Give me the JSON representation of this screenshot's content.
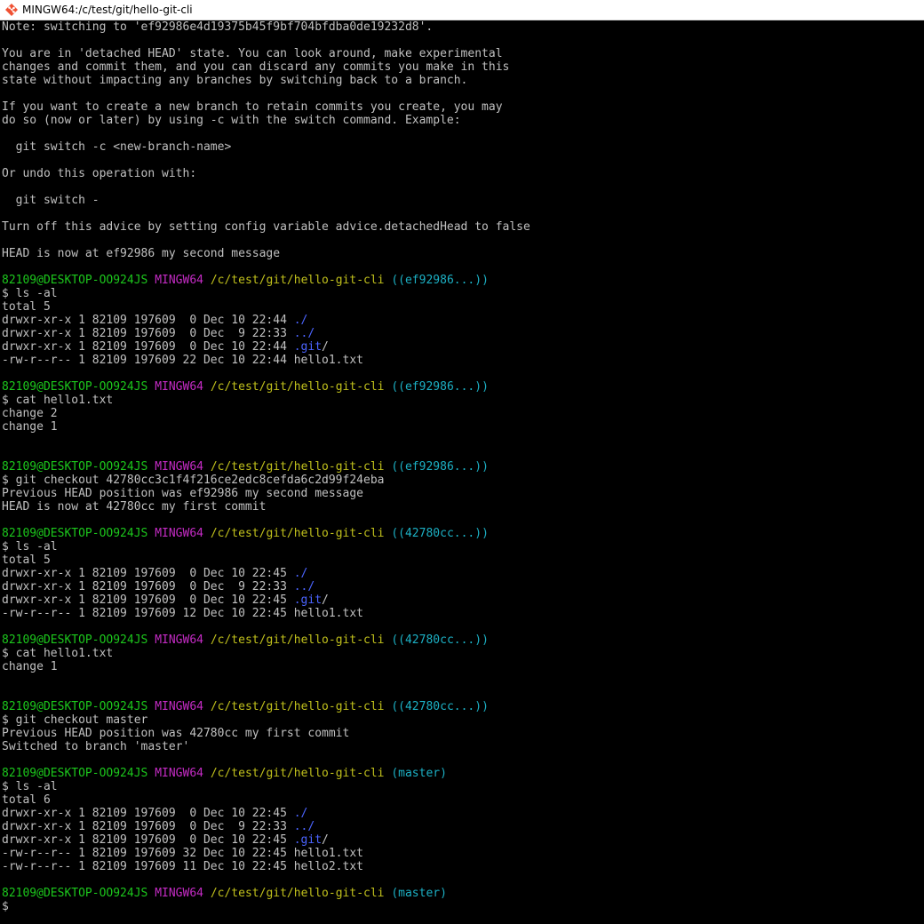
{
  "window": {
    "title": "MINGW64:/c/test/git/hello-git-cli"
  },
  "colors": {
    "background": "#000000",
    "text": "#c0c0c0",
    "user_host": "#1cc71c",
    "system": "#c42bc4",
    "path": "#c0c01c",
    "branch": "#1cb0c4",
    "directory": "#4b64ff"
  },
  "icons": {
    "app": "git-bash-icon"
  },
  "terminal": {
    "lines": [
      [
        {
          "t": "text",
          "v": "Note: switching to 'ef92986e4d19375b45f9bf704bfdba0de19232d8'."
        }
      ],
      [],
      [
        {
          "t": "text",
          "v": "You are in 'detached HEAD' state. You can look around, make experimental"
        }
      ],
      [
        {
          "t": "text",
          "v": "changes and commit them, and you can discard any commits you make in this"
        }
      ],
      [
        {
          "t": "text",
          "v": "state without impacting any branches by switching back to a branch."
        }
      ],
      [],
      [
        {
          "t": "text",
          "v": "If you want to create a new branch to retain commits you create, you may"
        }
      ],
      [
        {
          "t": "text",
          "v": "do so (now or later) by using -c with the switch command. Example:"
        }
      ],
      [],
      [
        {
          "t": "text",
          "v": "  git switch -c <new-branch-name>"
        }
      ],
      [],
      [
        {
          "t": "text",
          "v": "Or undo this operation with:"
        }
      ],
      [],
      [
        {
          "t": "text",
          "v": "  git switch -"
        }
      ],
      [],
      [
        {
          "t": "text",
          "v": "Turn off this advice by setting config variable advice.detachedHead to false"
        }
      ],
      [],
      [
        {
          "t": "text",
          "v": "HEAD is now at ef92986 my second message"
        }
      ],
      [],
      [
        {
          "t": "user",
          "v": "82109@DESKTOP-OO924JS"
        },
        {
          "t": "text",
          "v": " "
        },
        {
          "t": "sys",
          "v": "MINGW64"
        },
        {
          "t": "text",
          "v": " "
        },
        {
          "t": "path",
          "v": "/c/test/git/hello-git-cli"
        },
        {
          "t": "text",
          "v": " "
        },
        {
          "t": "branch",
          "v": "((ef92986...))"
        }
      ],
      [
        {
          "t": "text",
          "v": "$ ls -al"
        }
      ],
      [
        {
          "t": "text",
          "v": "total 5"
        }
      ],
      [
        {
          "t": "text",
          "v": "drwxr-xr-x 1 82109 197609  0 Dec 10 22:44 "
        },
        {
          "t": "dir",
          "v": "./"
        }
      ],
      [
        {
          "t": "text",
          "v": "drwxr-xr-x 1 82109 197609  0 Dec  9 22:33 "
        },
        {
          "t": "dir",
          "v": "../"
        }
      ],
      [
        {
          "t": "text",
          "v": "drwxr-xr-x 1 82109 197609  0 Dec 10 22:44 "
        },
        {
          "t": "dir",
          "v": ".git"
        },
        {
          "t": "text",
          "v": "/"
        }
      ],
      [
        {
          "t": "text",
          "v": "-rw-r--r-- 1 82109 197609 22 Dec 10 22:44 hello1.txt"
        }
      ],
      [],
      [
        {
          "t": "user",
          "v": "82109@DESKTOP-OO924JS"
        },
        {
          "t": "text",
          "v": " "
        },
        {
          "t": "sys",
          "v": "MINGW64"
        },
        {
          "t": "text",
          "v": " "
        },
        {
          "t": "path",
          "v": "/c/test/git/hello-git-cli"
        },
        {
          "t": "text",
          "v": " "
        },
        {
          "t": "branch",
          "v": "((ef92986...))"
        }
      ],
      [
        {
          "t": "text",
          "v": "$ cat hello1.txt"
        }
      ],
      [
        {
          "t": "text",
          "v": "change 2"
        }
      ],
      [
        {
          "t": "text",
          "v": "change 1"
        }
      ],
      [],
      [],
      [
        {
          "t": "user",
          "v": "82109@DESKTOP-OO924JS"
        },
        {
          "t": "text",
          "v": " "
        },
        {
          "t": "sys",
          "v": "MINGW64"
        },
        {
          "t": "text",
          "v": " "
        },
        {
          "t": "path",
          "v": "/c/test/git/hello-git-cli"
        },
        {
          "t": "text",
          "v": " "
        },
        {
          "t": "branch",
          "v": "((ef92986...))"
        }
      ],
      [
        {
          "t": "text",
          "v": "$ git checkout 42780cc3c1f4f216ce2edc8cefda6c2d99f24eba"
        }
      ],
      [
        {
          "t": "text",
          "v": "Previous HEAD position was ef92986 my second message"
        }
      ],
      [
        {
          "t": "text",
          "v": "HEAD is now at 42780cc my first commit"
        }
      ],
      [],
      [
        {
          "t": "user",
          "v": "82109@DESKTOP-OO924JS"
        },
        {
          "t": "text",
          "v": " "
        },
        {
          "t": "sys",
          "v": "MINGW64"
        },
        {
          "t": "text",
          "v": " "
        },
        {
          "t": "path",
          "v": "/c/test/git/hello-git-cli"
        },
        {
          "t": "text",
          "v": " "
        },
        {
          "t": "branch",
          "v": "((42780cc...))"
        }
      ],
      [
        {
          "t": "text",
          "v": "$ ls -al"
        }
      ],
      [
        {
          "t": "text",
          "v": "total 5"
        }
      ],
      [
        {
          "t": "text",
          "v": "drwxr-xr-x 1 82109 197609  0 Dec 10 22:45 "
        },
        {
          "t": "dir",
          "v": "./"
        }
      ],
      [
        {
          "t": "text",
          "v": "drwxr-xr-x 1 82109 197609  0 Dec  9 22:33 "
        },
        {
          "t": "dir",
          "v": "../"
        }
      ],
      [
        {
          "t": "text",
          "v": "drwxr-xr-x 1 82109 197609  0 Dec 10 22:45 "
        },
        {
          "t": "dir",
          "v": ".git"
        },
        {
          "t": "text",
          "v": "/"
        }
      ],
      [
        {
          "t": "text",
          "v": "-rw-r--r-- 1 82109 197609 12 Dec 10 22:45 hello1.txt"
        }
      ],
      [],
      [
        {
          "t": "user",
          "v": "82109@DESKTOP-OO924JS"
        },
        {
          "t": "text",
          "v": " "
        },
        {
          "t": "sys",
          "v": "MINGW64"
        },
        {
          "t": "text",
          "v": " "
        },
        {
          "t": "path",
          "v": "/c/test/git/hello-git-cli"
        },
        {
          "t": "text",
          "v": " "
        },
        {
          "t": "branch",
          "v": "((42780cc...))"
        }
      ],
      [
        {
          "t": "text",
          "v": "$ cat hello1.txt"
        }
      ],
      [
        {
          "t": "text",
          "v": "change 1"
        }
      ],
      [],
      [],
      [
        {
          "t": "user",
          "v": "82109@DESKTOP-OO924JS"
        },
        {
          "t": "text",
          "v": " "
        },
        {
          "t": "sys",
          "v": "MINGW64"
        },
        {
          "t": "text",
          "v": " "
        },
        {
          "t": "path",
          "v": "/c/test/git/hello-git-cli"
        },
        {
          "t": "text",
          "v": " "
        },
        {
          "t": "branch",
          "v": "((42780cc...))"
        }
      ],
      [
        {
          "t": "text",
          "v": "$ git checkout master"
        }
      ],
      [
        {
          "t": "text",
          "v": "Previous HEAD position was 42780cc my first commit"
        }
      ],
      [
        {
          "t": "text",
          "v": "Switched to branch 'master'"
        }
      ],
      [],
      [
        {
          "t": "user",
          "v": "82109@DESKTOP-OO924JS"
        },
        {
          "t": "text",
          "v": " "
        },
        {
          "t": "sys",
          "v": "MINGW64"
        },
        {
          "t": "text",
          "v": " "
        },
        {
          "t": "path",
          "v": "/c/test/git/hello-git-cli"
        },
        {
          "t": "text",
          "v": " "
        },
        {
          "t": "branch",
          "v": "(master)"
        }
      ],
      [
        {
          "t": "text",
          "v": "$ ls -al"
        }
      ],
      [
        {
          "t": "text",
          "v": "total 6"
        }
      ],
      [
        {
          "t": "text",
          "v": "drwxr-xr-x 1 82109 197609  0 Dec 10 22:45 "
        },
        {
          "t": "dir",
          "v": "./"
        }
      ],
      [
        {
          "t": "text",
          "v": "drwxr-xr-x 1 82109 197609  0 Dec  9 22:33 "
        },
        {
          "t": "dir",
          "v": "../"
        }
      ],
      [
        {
          "t": "text",
          "v": "drwxr-xr-x 1 82109 197609  0 Dec 10 22:45 "
        },
        {
          "t": "dir",
          "v": ".git"
        },
        {
          "t": "text",
          "v": "/"
        }
      ],
      [
        {
          "t": "text",
          "v": "-rw-r--r-- 1 82109 197609 32 Dec 10 22:45 hello1.txt"
        }
      ],
      [
        {
          "t": "text",
          "v": "-rw-r--r-- 1 82109 197609 11 Dec 10 22:45 hello2.txt"
        }
      ],
      [],
      [
        {
          "t": "user",
          "v": "82109@DESKTOP-OO924JS"
        },
        {
          "t": "text",
          "v": " "
        },
        {
          "t": "sys",
          "v": "MINGW64"
        },
        {
          "t": "text",
          "v": " "
        },
        {
          "t": "path",
          "v": "/c/test/git/hello-git-cli"
        },
        {
          "t": "text",
          "v": " "
        },
        {
          "t": "branch",
          "v": "(master)"
        }
      ],
      [
        {
          "t": "text",
          "v": "$"
        }
      ]
    ]
  }
}
